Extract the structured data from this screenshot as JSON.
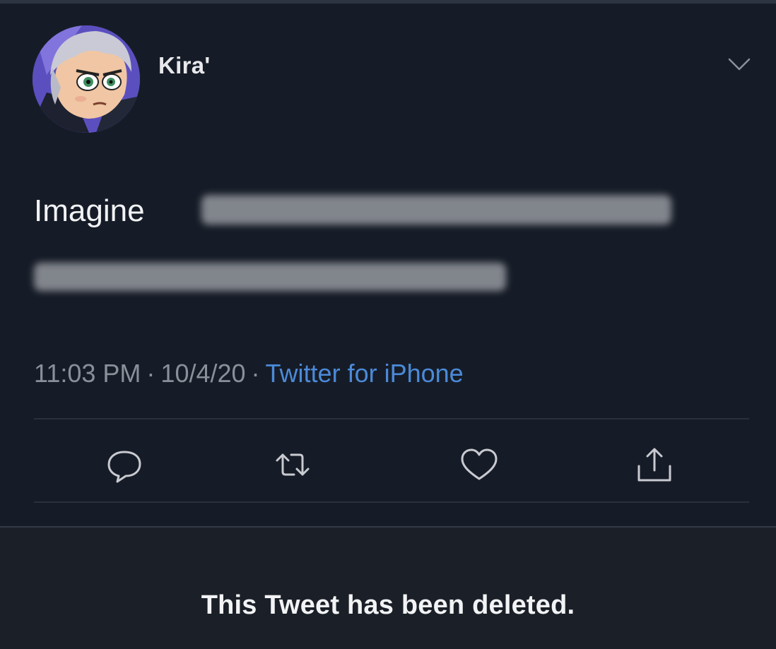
{
  "tweet": {
    "author": {
      "display_name": "Kira'",
      "avatar": "cartoon-character-avatar"
    },
    "text_prefix": "Imagine",
    "redacted": true,
    "timestamp": "11:03 PM",
    "separator": "·",
    "date": "10/4/20",
    "source": "Twitter for iPhone",
    "actions": [
      "reply-icon",
      "retweet-icon",
      "like-icon",
      "share-icon"
    ],
    "menu_icon": "chevron-down-icon"
  },
  "status": {
    "message": "This Tweet has been deleted."
  },
  "colors": {
    "background": "#161c27",
    "text": "#f1f2f4",
    "muted": "#8a8f99",
    "link": "#4b8ad9",
    "divider": "#2b313c"
  }
}
